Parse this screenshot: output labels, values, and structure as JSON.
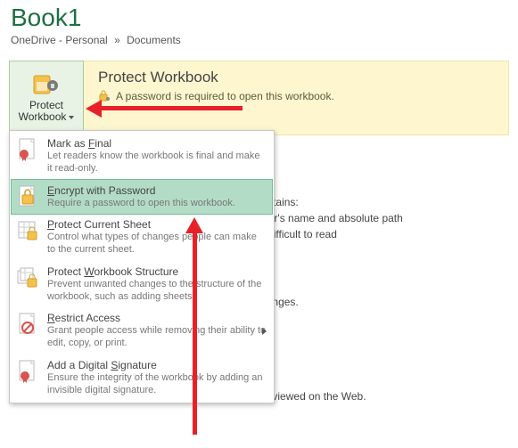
{
  "header": {
    "title": "Book1",
    "breadcrumb": {
      "loc1": "OneDrive - Personal",
      "sep": "»",
      "loc2": "Documents"
    }
  },
  "protectButton": {
    "line1": "Protect",
    "line2": "Workbook"
  },
  "infoPanel": {
    "title": "Protect Workbook",
    "message": "A password is required to open this workbook."
  },
  "menu": {
    "items": [
      {
        "title_pre": "Mark as ",
        "title_ul": "F",
        "title_post": "inal",
        "desc": "Let readers know the workbook is final and make it read-only."
      },
      {
        "title_pre": "",
        "title_ul": "E",
        "title_post": "ncrypt with Password",
        "desc": "Require a password to open this workbook."
      },
      {
        "title_pre": "",
        "title_ul": "P",
        "title_post": "rotect Current Sheet",
        "desc": "Control what types of changes people can make to the current sheet."
      },
      {
        "title_pre": "Protect ",
        "title_ul": "W",
        "title_post": "orkbook Structure",
        "desc": "Prevent unwanted changes to the structure of the workbook, such as adding sheets."
      },
      {
        "title_pre": "",
        "title_ul": "R",
        "title_post": "estrict Access",
        "desc": "Grant people access while removing their ability to edit, copy, or print."
      },
      {
        "title_pre": "Add a Digital ",
        "title_ul": "S",
        "title_post": "ignature",
        "desc": "Ensure the integrity of the workbook by adding an invisible digital signature."
      }
    ]
  },
  "bodyText": {
    "l1": "                                          that it contains:",
    "l2": "                                          ath, author's name and absolute path",
    "l3": "                                        ilities find difficult to read",
    "l4": "                                         saved changes.",
    "l5": "                                        orkbook is viewed on the Web."
  },
  "icons": {
    "protect": "shield-lock-icon",
    "miniLock": "lock-key-icon",
    "final": "document-seal-icon",
    "encrypt": "document-lock-icon",
    "sheet": "sheet-lock-icon",
    "structure": "workbook-lock-icon",
    "restrict": "document-restrict-icon",
    "signature": "document-signature-icon"
  },
  "colors": {
    "accent": "#1d7044",
    "highlight": "#b3dcc7",
    "panel": "#fdf6cf",
    "arrow": "#e8202a"
  }
}
